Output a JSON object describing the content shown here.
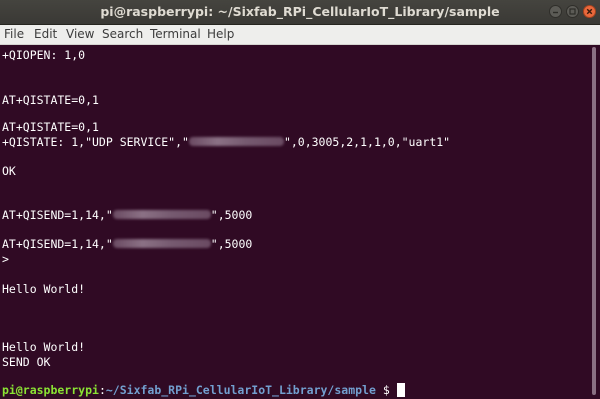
{
  "window": {
    "title": "pi@raspberrypi: ~/Sixfab_RPi_CellularIoT_Library/sample"
  },
  "menu": {
    "file": "File",
    "edit": "Edit",
    "view": "View",
    "search": "Search",
    "terminal": "Terminal",
    "help": "Help"
  },
  "terminal": {
    "l1": "+QIOPEN: 1,0",
    "l2": "AT+QISTATE=0,1",
    "l3": "AT+QISTATE=0,1",
    "l4a": "+QISTATE: 1,\"UDP SERVICE\",\"",
    "l4b": "\",0,3005,2,1,1,0,\"uart1\"",
    "l5": "OK",
    "l6a": "AT+QISEND=1,14,\"",
    "l6b": "\",5000",
    "l7a": "AT+QISEND=1,14,\"",
    "l7b": "\",5000",
    "l8": ">",
    "l9": "Hello World!",
    "l10": "Hello World!",
    "l11": "SEND OK",
    "prompt_user": "pi@raspberrypi",
    "prompt_sep": ":",
    "prompt_path": "~/Sixfab_RPi_CellularIoT_Library/sample",
    "prompt_symbol": " $ "
  },
  "icons": {
    "minimize": "minimize-icon",
    "maximize": "maximize-icon",
    "close": "close-icon"
  },
  "colors": {
    "terminal_bg": "#300a24",
    "prompt_user": "#8ae234",
    "prompt_path": "#729fcf",
    "close_button": "#e9683c"
  }
}
